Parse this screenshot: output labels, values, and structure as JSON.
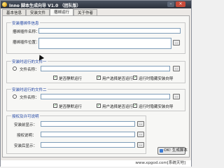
{
  "window": {
    "title": "Inno 脚本生成向导 V1.0 （团队版）",
    "minimize_glyph": "–",
    "close_glyph": "×"
  },
  "tabs": [
    {
      "label": "基本信息"
    },
    {
      "label": "安装文件"
    },
    {
      "label": "捆绑运行",
      "active": true
    },
    {
      "label": "关于作者"
    }
  ],
  "bundle_info": {
    "legend": "安装捆绑件信息",
    "name_label": "捆绑插件名称：",
    "name_value": "",
    "position_label": "捆绑插件位置：",
    "position_value": ""
  },
  "run_file_1": {
    "legend": "安装时运行的文件一",
    "file_label": "文件名称：",
    "file_value": "",
    "options": [
      {
        "label": "是否静默运行",
        "checked": true
      },
      {
        "label": "用户选择是否运行",
        "checked": true
      },
      {
        "label": "运行时隐藏安装向导",
        "checked": true
      }
    ]
  },
  "run_file_2": {
    "legend": "安装时运行的文件二",
    "file_label": "文件名称：",
    "file_value": "",
    "options": [
      {
        "label": "是否静默运行",
        "checked": true
      },
      {
        "label": "用户选择是否运行",
        "checked": true
      },
      {
        "label": "运行时隐藏安装向导",
        "checked": true
      }
    ]
  },
  "license": {
    "legend": "授权及许可说明",
    "pre_label": "安装前显示：",
    "pre_value": "",
    "auth_label": "授权说明：",
    "auth_value": "",
    "post_label": "安装后显示：",
    "post_value": ""
  },
  "browse_glyph": "...",
  "check_glyph": "✓",
  "generate_button": "OK! 生成脚本",
  "watermark": "www.xpgod.com[系统天地]"
}
